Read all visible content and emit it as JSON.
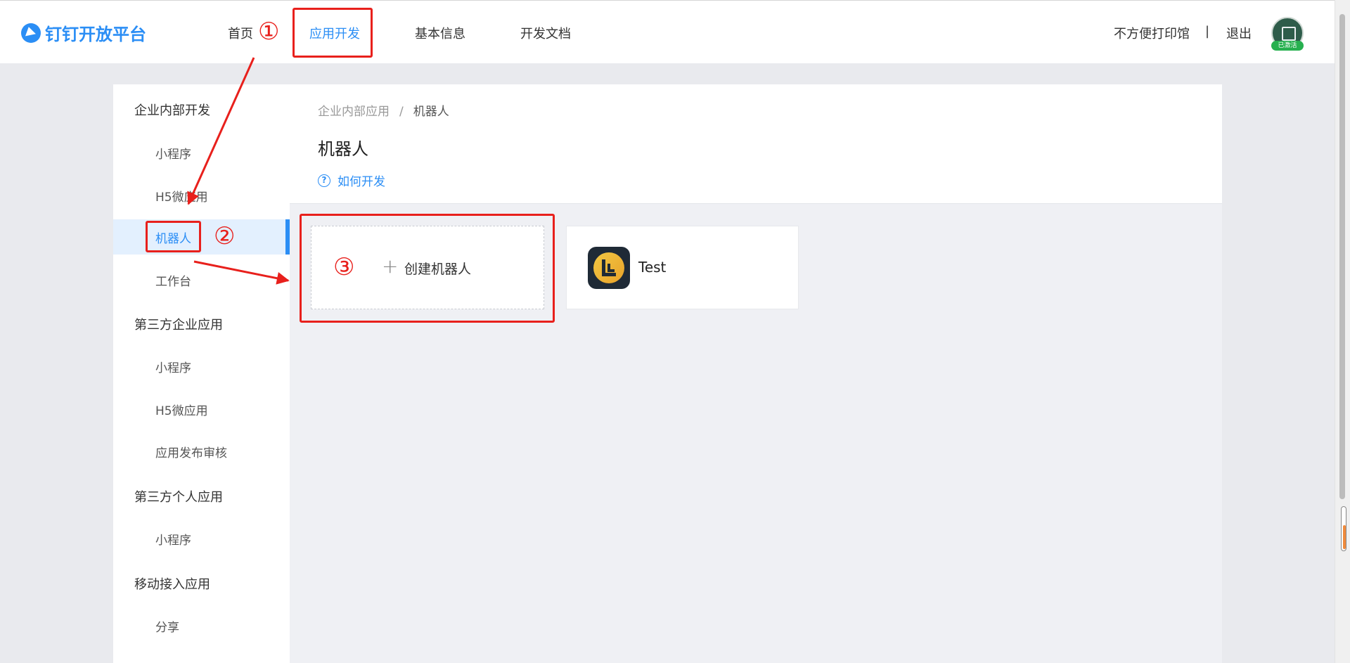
{
  "header": {
    "logo_text": "钉钉开放平台",
    "nav": [
      {
        "label": "首页"
      },
      {
        "label": "应用开发",
        "active": true
      },
      {
        "label": "基本信息"
      },
      {
        "label": "开发文档"
      }
    ],
    "user_name": "不方便打印馆",
    "divider": "|",
    "logout": "退出",
    "avatar_badge": "已激活"
  },
  "sidebar": {
    "groups": [
      {
        "label": "企业内部开发",
        "items": [
          "小程序",
          "H5微应用",
          "机器人",
          "工作台"
        ]
      },
      {
        "label": "第三方企业应用",
        "items": [
          "小程序",
          "H5微应用",
          "应用发布审核"
        ]
      },
      {
        "label": "第三方个人应用",
        "items": [
          "小程序"
        ]
      },
      {
        "label": "移动接入应用",
        "items": [
          "分享"
        ]
      }
    ],
    "active_item": "机器人"
  },
  "main": {
    "breadcrumb": [
      "企业内部应用",
      "机器人"
    ],
    "breadcrumb_sep": "/",
    "title": "机器人",
    "help_link": "如何开发",
    "create_card": {
      "plus": "+",
      "label": "创建机器人"
    },
    "apps": [
      {
        "name": "Test"
      }
    ]
  },
  "annotations": [
    "①",
    "②",
    "③"
  ],
  "colors": {
    "accent": "#2b8ef5",
    "annotation": "#e8201c",
    "active_bg": "#e3f0fe",
    "page_bg": "#e9eaee"
  }
}
